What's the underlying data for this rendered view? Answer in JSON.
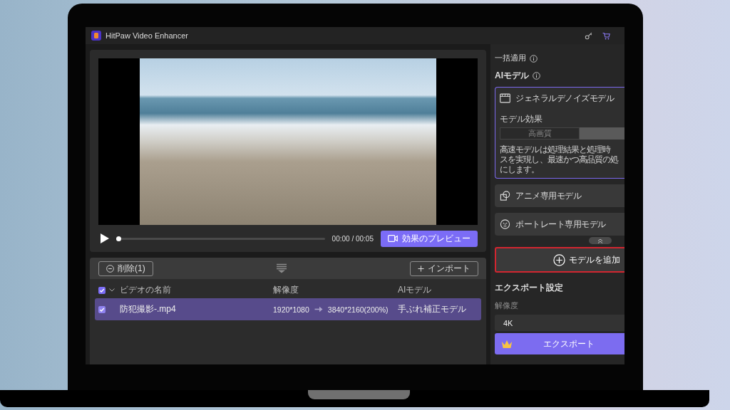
{
  "window": {
    "title": "HitPaw Video Enhancer"
  },
  "player": {
    "progress": {
      "level": 0
    },
    "time": "00:00 / 00:05",
    "preview_button": "効果のプレビュー"
  },
  "file_list": {
    "delete_button": "削除(1)",
    "import_button": "インポート",
    "select_all": {
      "checked": true
    },
    "columns": [
      "ビデオの名前",
      "解像度",
      "AIモデル"
    ],
    "rows": [
      {
        "name": "防犯撮影-.mp4",
        "source_resolution": "1920*1080",
        "target_resolution": "3840*2160(200%)",
        "model": "手ぶれ補正モデル",
        "selected": true,
        "checked": true
      }
    ]
  },
  "side_panel": {
    "batch_apply": "一括適用",
    "models_title": "AIモデル",
    "models": [
      {
        "kind": "general",
        "name": "ジェネラルデノイズモデル",
        "selected": true,
        "effect_label": "モデル効果",
        "effect_options": [
          {
            "label": "高画質",
            "selected": false
          },
          {
            "selected": true
          }
        ],
        "description": [
          "高速モデルは処理結果と処理時",
          "スを実現し、最速かつ高品質の処",
          "にします。"
        ]
      },
      {
        "kind": "anime",
        "name": "アニメ専用モデル",
        "selected": false
      },
      {
        "kind": "portrait",
        "name": "ポートレート専用モデル",
        "selected": false
      }
    ],
    "add_model": {
      "label": "モデルを追加",
      "highlighted": true
    },
    "export": {
      "title": "エクスポート設定",
      "resolution_label": "解像度",
      "resolution": "4K",
      "button": "エクスポート"
    }
  }
}
